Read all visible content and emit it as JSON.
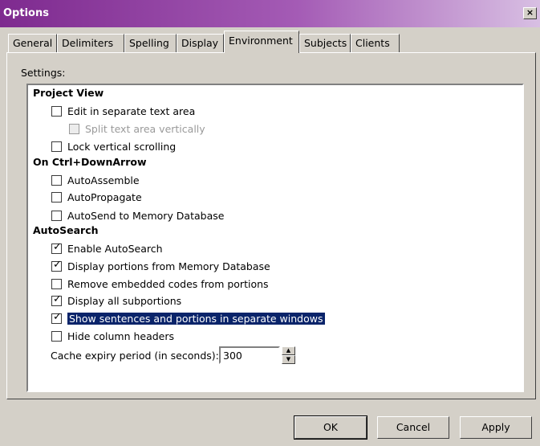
{
  "window": {
    "title": "Options",
    "close_label": "×"
  },
  "tabs": [
    {
      "label": "General"
    },
    {
      "label": "Delimiters"
    },
    {
      "label": "Spelling"
    },
    {
      "label": "Display"
    },
    {
      "label": "Environment",
      "active": true
    },
    {
      "label": "Subjects"
    },
    {
      "label": "Clients"
    }
  ],
  "settings": {
    "label": "Settings:",
    "groups": [
      {
        "title": "Project View"
      },
      {
        "title": "On Ctrl+DownArrow"
      },
      {
        "title": "AutoSearch"
      }
    ],
    "items": [
      {
        "label": "Edit in separate text area",
        "checked": false
      },
      {
        "label": "Split text area vertically",
        "checked": false,
        "disabled": true
      },
      {
        "label": "Lock vertical scrolling",
        "checked": false
      },
      {
        "label": "AutoAssemble",
        "checked": false
      },
      {
        "label": "AutoPropagate",
        "checked": false
      },
      {
        "label": "AutoSend to Memory Database",
        "checked": false
      },
      {
        "label": "Enable AutoSearch",
        "checked": true
      },
      {
        "label": "Display portions from Memory Database",
        "checked": true
      },
      {
        "label": "Remove embedded codes from portions",
        "checked": false
      },
      {
        "label": "Display all subportions",
        "checked": true
      },
      {
        "label": "Show sentences and portions in separate windows",
        "checked": true,
        "selected": true
      },
      {
        "label": "Hide column headers",
        "checked": false
      }
    ],
    "cache": {
      "label": "Cache expiry period (in seconds):",
      "value": "300"
    }
  },
  "buttons": {
    "ok": "OK",
    "cancel": "Cancel",
    "apply": "Apply"
  },
  "colors": {
    "title_bar": "#7e2a8f",
    "selection": "#0a246a",
    "face": "#d4d0c8"
  }
}
